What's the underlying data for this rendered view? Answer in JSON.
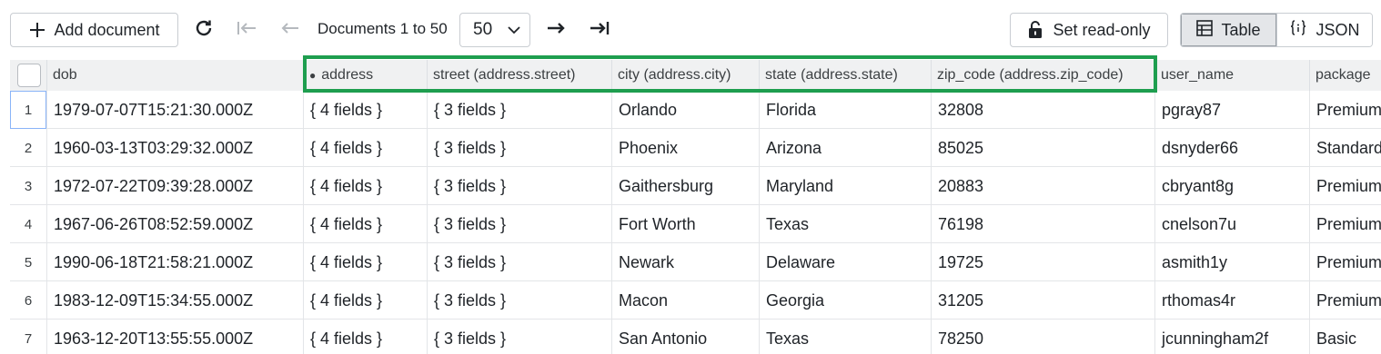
{
  "toolbar": {
    "add_label": "Add document",
    "range_text": "Documents 1 to 50",
    "page_size": "50",
    "readonly_label": "Set read-only",
    "view_table": "Table",
    "view_json": "JSON"
  },
  "icons": {
    "add": "plus-icon",
    "refresh": "refresh-icon",
    "first": "first-page-icon",
    "prev": "previous-page-icon",
    "next": "next-page-icon",
    "last": "last-page-icon",
    "lock": "unlock-icon",
    "table": "table-icon",
    "json": "json-braces-icon"
  },
  "columns": [
    "dob",
    "address",
    "street (address.street)",
    "city (address.city)",
    "state (address.state)",
    "zip_code (address.zip_code)",
    "user_name",
    "package"
  ],
  "highlight_color": "#1e9e4f",
  "rows": [
    {
      "n": "1",
      "dob": "1979-07-07T15:21:30.000Z",
      "address": "{ 4 fields }",
      "street": "{ 3 fields }",
      "city": "Orlando",
      "state": "Florida",
      "zip": "32808",
      "user": "pgray87",
      "package": "Premium"
    },
    {
      "n": "2",
      "dob": "1960-03-13T03:29:32.000Z",
      "address": "{ 4 fields }",
      "street": "{ 3 fields }",
      "city": "Phoenix",
      "state": "Arizona",
      "zip": "85025",
      "user": "dsnyder66",
      "package": "Standard"
    },
    {
      "n": "3",
      "dob": "1972-07-22T09:39:28.000Z",
      "address": "{ 4 fields }",
      "street": "{ 3 fields }",
      "city": "Gaithersburg",
      "state": "Maryland",
      "zip": "20883",
      "user": "cbryant8g",
      "package": "Premium"
    },
    {
      "n": "4",
      "dob": "1967-06-26T08:52:59.000Z",
      "address": "{ 4 fields }",
      "street": "{ 3 fields }",
      "city": "Fort Worth",
      "state": "Texas",
      "zip": "76198",
      "user": "cnelson7u",
      "package": "Premium"
    },
    {
      "n": "5",
      "dob": "1990-06-18T21:58:21.000Z",
      "address": "{ 4 fields }",
      "street": "{ 3 fields }",
      "city": "Newark",
      "state": "Delaware",
      "zip": "19725",
      "user": "asmith1y",
      "package": "Premium"
    },
    {
      "n": "6",
      "dob": "1983-12-09T15:34:55.000Z",
      "address": "{ 4 fields }",
      "street": "{ 3 fields }",
      "city": "Macon",
      "state": "Georgia",
      "zip": "31205",
      "user": "rthomas4r",
      "package": "Premium"
    },
    {
      "n": "7",
      "dob": "1963-12-20T13:55:55.000Z",
      "address": "{ 4 fields }",
      "street": "{ 3 fields }",
      "city": "San Antonio",
      "state": "Texas",
      "zip": "78250",
      "user": "jcunningham2f",
      "package": "Basic"
    }
  ]
}
